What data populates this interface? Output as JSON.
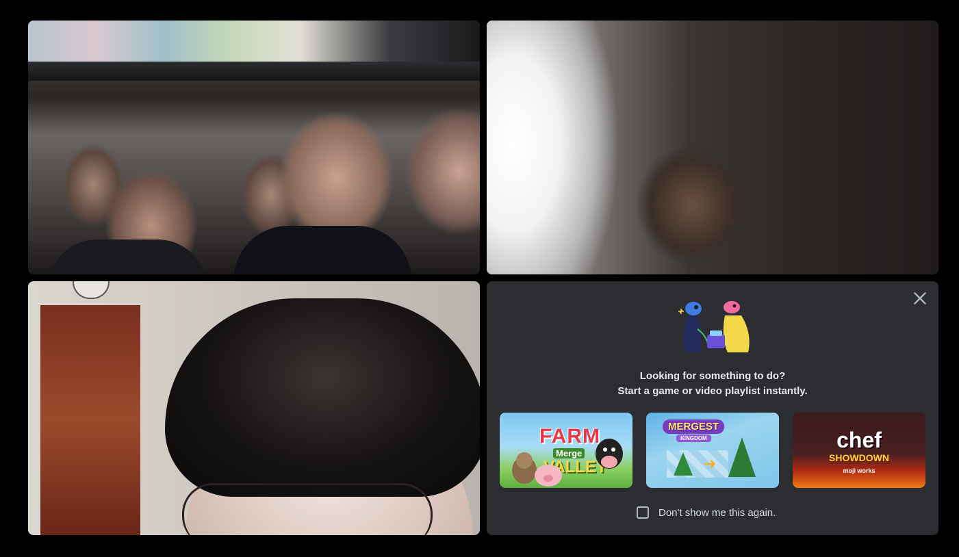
{
  "prompt": {
    "headline": "Looking for something to do?",
    "subline": "Start a game or video playlist instantly.",
    "dont_show_label": "Don't show me this again.",
    "dont_show_checked": false,
    "close_icon": "close-icon",
    "hero_icon": "activity-characters-illustration"
  },
  "activities": [
    {
      "title": "FARM",
      "subtitle": "Merge",
      "subtitle2": "VALLEY"
    },
    {
      "title": "MERGEST",
      "subtitle": "KINGDOM"
    },
    {
      "title": "chef",
      "subtitle": "SHOWDOWN",
      "brand": "moji works"
    }
  ],
  "colors": {
    "background": "#000000",
    "tile": "#2b2d31",
    "text_primary": "#e6e7e9"
  }
}
